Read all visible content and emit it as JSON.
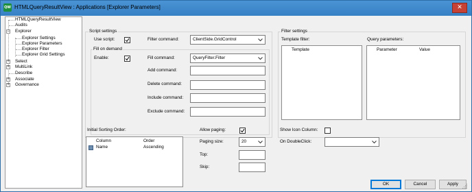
{
  "window": {
    "title": "HTMLQueryResultView : Applications    [Explorer Parameters]",
    "app_icon_text": "QW",
    "close_glyph": "✕"
  },
  "tree": {
    "items": [
      {
        "label": "HTMLQueryResultView",
        "expander": ""
      },
      {
        "label": "Audits",
        "expander": ""
      },
      {
        "label": "Explorer",
        "expander": "−"
      },
      {
        "label": "Explorer Settings",
        "expander": ""
      },
      {
        "label": "Explorer Parameters",
        "expander": ""
      },
      {
        "label": "Explorer Filter",
        "expander": ""
      },
      {
        "label": "Explorer Grid Settings",
        "expander": ""
      },
      {
        "label": "Select",
        "expander": "+"
      },
      {
        "label": "MultiLink",
        "expander": "+"
      },
      {
        "label": "Describe",
        "expander": ""
      },
      {
        "label": "Associate",
        "expander": "+"
      },
      {
        "label": "Governance",
        "expander": "+"
      }
    ]
  },
  "script_settings": {
    "title": "Script settings",
    "use_script_label": "Use script:",
    "use_script_checked": true,
    "filter_command_label": "Filter command:",
    "filter_command_value": "ClientSide.GridControl",
    "fill_on_demand": {
      "title": "Fill on demand",
      "enable_label": "Enable:",
      "enable_checked": true,
      "fill_command_label": "Fill command:",
      "fill_command_value": "QueryFilter.Filter",
      "add_command_label": "Add command:",
      "add_command_value": "",
      "delete_command_label": "Delete command:",
      "delete_command_value": "",
      "include_command_label": "Include command:",
      "include_command_value": "",
      "exclude_command_label": "Exclude command:",
      "exclude_command_value": ""
    }
  },
  "filter_settings": {
    "title": "Filter settings",
    "template_filter_label": "Template filter:",
    "template_column": "Template",
    "query_parameters_label": "Query parameters:",
    "parameter_column": "Parameter",
    "value_column": "Value"
  },
  "sorting": {
    "label": "Initial Sorting Order:",
    "columns": [
      "Column",
      "Order"
    ],
    "rows": [
      {
        "column": "Name",
        "order": "Ascending"
      }
    ]
  },
  "paging": {
    "allow_paging_label": "Allow paging:",
    "allow_paging_checked": true,
    "paging_size_label": "Paging size:",
    "paging_size_value": "20",
    "top_label": "Top:",
    "top_value": "",
    "skip_label": "Skip:",
    "skip_value": ""
  },
  "misc": {
    "show_icon_column_label": "Show Icon Column:",
    "show_icon_column_checked": false,
    "on_double_click_label": "On DoubleClick:",
    "on_double_click_value": ""
  },
  "buttons": {
    "ok": "OK",
    "cancel": "Cancel",
    "apply": "Apply"
  }
}
